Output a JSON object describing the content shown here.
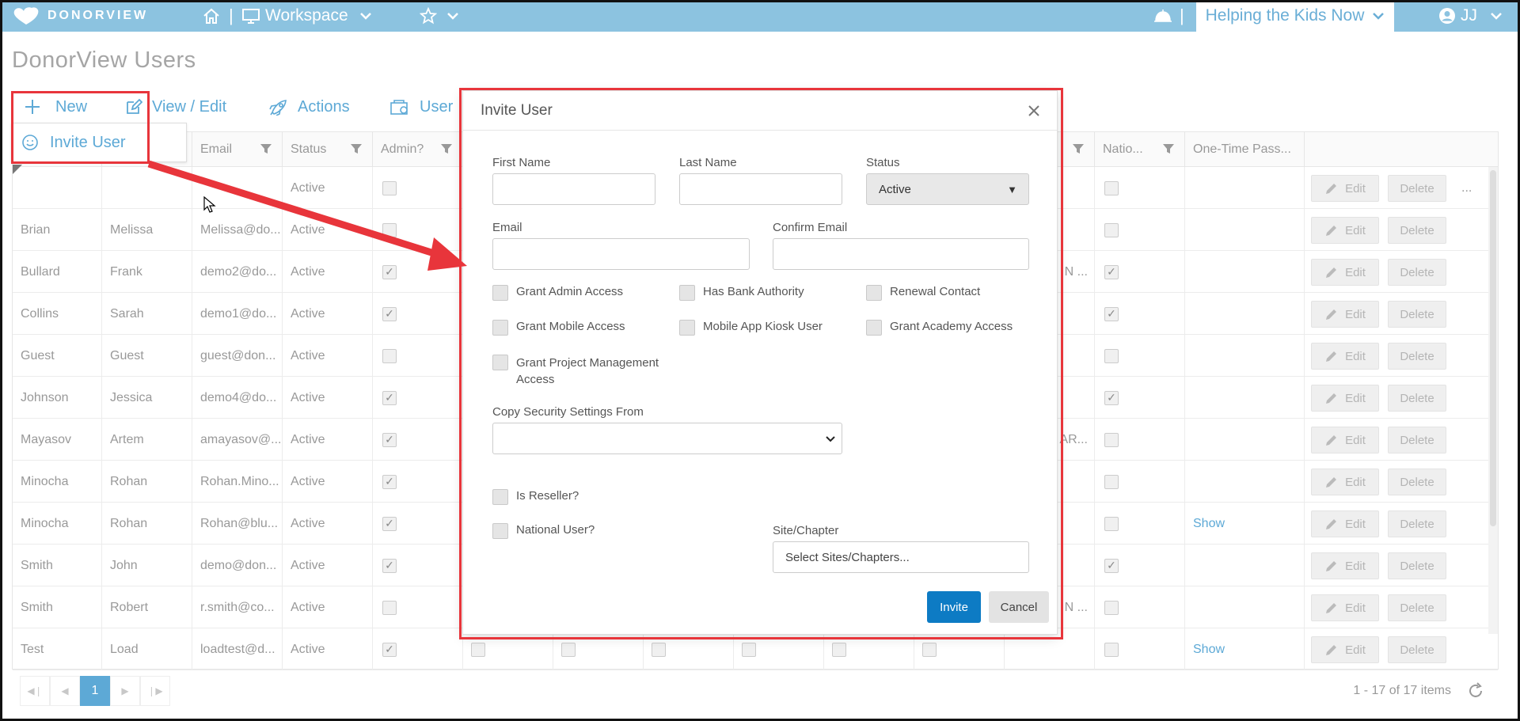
{
  "topbar": {
    "logo_text": "DONORVIEW",
    "workspace_label": "Workspace",
    "org_label": "Helping the Kids Now",
    "user_initials": "JJ"
  },
  "page": {
    "title": "DonorView Users"
  },
  "toolbar": {
    "new_label": "New",
    "view_edit_label": "View / Edit",
    "actions_label": "Actions",
    "user_label": "User"
  },
  "new_menu": {
    "invite_user_label": "Invite User"
  },
  "grid": {
    "headers": {
      "email": "Email",
      "status": "Status",
      "admin": "Admin?",
      "national": "Natio...",
      "otp": "One-Time Pass..."
    },
    "rows": [
      {
        "last": "",
        "first": "",
        "email": "",
        "status": "Active",
        "admin": false,
        "trunc": "",
        "national": false,
        "otp": "",
        "more": "..."
      },
      {
        "last": "Brian",
        "first": "Melissa",
        "email": "Melissa@do...",
        "status": "Active",
        "admin": false,
        "trunc": "",
        "national": false,
        "otp": "",
        "more": ""
      },
      {
        "last": "Bullard",
        "first": "Frank",
        "email": "demo2@do...",
        "status": "Active",
        "admin": true,
        "trunc": "N ...",
        "national": true,
        "otp": "",
        "more": ""
      },
      {
        "last": "Collins",
        "first": "Sarah",
        "email": "demo1@do...",
        "status": "Active",
        "admin": true,
        "trunc": "",
        "national": true,
        "otp": "",
        "more": ""
      },
      {
        "last": "Guest",
        "first": "Guest",
        "email": "guest@don...",
        "status": "Active",
        "admin": false,
        "trunc": "",
        "national": false,
        "otp": "",
        "more": ""
      },
      {
        "last": "Johnson",
        "first": "Jessica",
        "email": "demo4@do...",
        "status": "Active",
        "admin": true,
        "trunc": "",
        "national": true,
        "otp": "",
        "more": ""
      },
      {
        "last": "Mayasov",
        "first": "Artem",
        "email": "amayasov@...",
        "status": "Active",
        "admin": true,
        "trunc": "AR...",
        "national": false,
        "otp": "",
        "more": ""
      },
      {
        "last": "Minocha",
        "first": "Rohan",
        "email": "Rohan.Mino...",
        "status": "Active",
        "admin": true,
        "trunc": "",
        "national": false,
        "otp": "",
        "more": ""
      },
      {
        "last": "Minocha",
        "first": "Rohan",
        "email": "Rohan@blu...",
        "status": "Active",
        "admin": true,
        "trunc": "",
        "national": false,
        "otp": "Show",
        "more": ""
      },
      {
        "last": "Smith",
        "first": "John",
        "email": "demo@don...",
        "status": "Active",
        "admin": true,
        "trunc": "",
        "national": true,
        "otp": "",
        "more": ""
      },
      {
        "last": "Smith",
        "first": "Robert",
        "email": "r.smith@co...",
        "status": "Active",
        "admin": false,
        "trunc": "N ...",
        "national": false,
        "otp": "",
        "more": ""
      },
      {
        "last": "Test",
        "first": "Load",
        "email": "loadtest@d...",
        "status": "Active",
        "admin": true,
        "trunc": "",
        "national": false,
        "otp": "Show",
        "more": ""
      }
    ],
    "edit_label": "Edit",
    "delete_label": "Delete"
  },
  "pager": {
    "current_page": "1",
    "info": "1 - 17 of 17 items"
  },
  "modal": {
    "title": "Invite User",
    "first_name_label": "First Name",
    "last_name_label": "Last Name",
    "status_label": "Status",
    "status_value": "Active",
    "email_label": "Email",
    "confirm_email_label": "Confirm Email",
    "checkboxes": {
      "grant_admin": "Grant Admin Access",
      "bank_authority": "Has Bank Authority",
      "renewal_contact": "Renewal Contact",
      "grant_mobile": "Grant Mobile Access",
      "kiosk_user": "Mobile App Kiosk User",
      "grant_academy": "Grant Academy Access",
      "grant_pm_line1": "Grant Project Management",
      "grant_pm_line2": "Access",
      "is_reseller": "Is Reseller?",
      "national_user": "National User?"
    },
    "copy_security_label": "Copy Security Settings From",
    "copy_security_value": "",
    "site_chapter_label": "Site/Chapter",
    "site_chapter_placeholder": "Select Sites/Chapters...",
    "invite_label": "Invite",
    "cancel_label": "Cancel"
  },
  "colors": {
    "topbar": "#8cc3e0",
    "accent": "#5da9d6",
    "primary_button": "#0d7bc4",
    "highlight": "#e8353b"
  }
}
